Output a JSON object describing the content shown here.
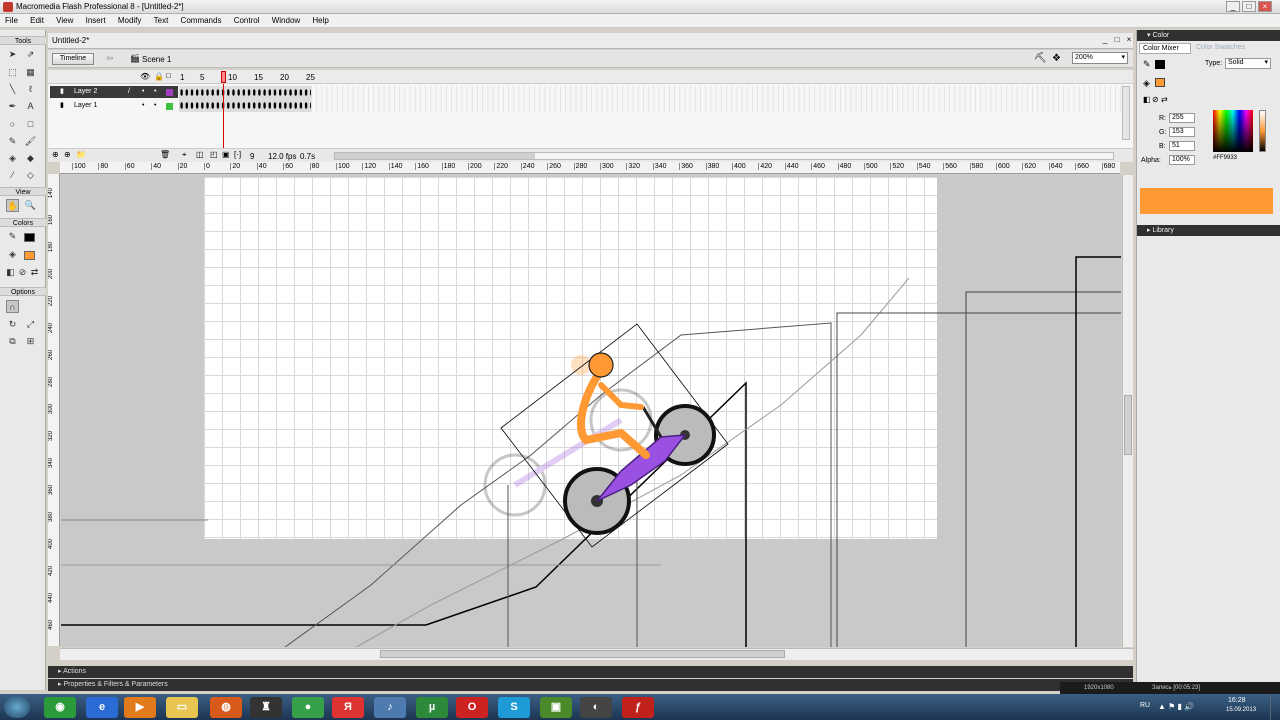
{
  "window": {
    "title": "Macromedia Flash Professional 8 - [Untitled-2*]"
  },
  "menu": [
    "File",
    "Edit",
    "View",
    "Insert",
    "Modify",
    "Text",
    "Commands",
    "Control",
    "Window",
    "Help"
  ],
  "tools": {
    "title": "Tools",
    "view_label": "View",
    "colors_label": "Colors",
    "options_label": "Options"
  },
  "document": {
    "tab": "Untitled-2*",
    "timeline_button": "Timeline",
    "scene": "Scene 1",
    "zoom": "200%"
  },
  "timeline": {
    "layers": [
      {
        "name": "Layer 2",
        "selected": true
      },
      {
        "name": "Layer 1",
        "selected": false
      }
    ],
    "frame_numbers": [
      "1",
      "5",
      "10",
      "15",
      "20",
      "25"
    ],
    "current_frame": "9",
    "fps": "12.0 fps",
    "time": "0.7s"
  },
  "ruler": {
    "h_ticks": [
      "100",
      "80",
      "60",
      "40",
      "20",
      "0",
      "20",
      "40",
      "60",
      "80",
      "100",
      "120",
      "140",
      "160",
      "180",
      "200",
      "220",
      "240",
      "260",
      "280",
      "300",
      "320",
      "340",
      "360",
      "380",
      "400",
      "420",
      "440",
      "460",
      "480",
      "500",
      "520",
      "540",
      "560",
      "580",
      "600",
      "620",
      "640",
      "660",
      "680"
    ],
    "v_ticks": [
      "140",
      "160",
      "180",
      "200",
      "220",
      "240",
      "260",
      "280",
      "300",
      "320",
      "340",
      "360",
      "380",
      "400",
      "420",
      "440",
      "460"
    ]
  },
  "panels": {
    "actions": "Actions",
    "properties": "Properties & Filters & Parameters"
  },
  "color_panel": {
    "title": "Color",
    "tab_mixer": "Color Mixer",
    "tab_swatches": "Color Swatches",
    "type_label": "Type:",
    "type_value": "Solid",
    "r_label": "R:",
    "r_value": "255",
    "g_label": "G:",
    "g_value": "153",
    "b_label": "B:",
    "b_value": "51",
    "alpha_label": "Alpha:",
    "alpha_value": "100%",
    "hex": "#FF9933",
    "swatch_color": "#FF9933"
  },
  "library": {
    "title": "Library"
  },
  "status_strip": {
    "resolution": "1920x1080",
    "recording": "Запись [00:05:23]"
  },
  "taskbar": {
    "lang": "RU",
    "time": "16:28",
    "date": "15.09.2013",
    "apps": [
      "chrome-icon",
      "ie-icon",
      "media-player-icon",
      "explorer-icon",
      "firefox-icon",
      "gamepad-icon",
      "ball-icon",
      "yandex-icon",
      "audio-icon",
      "utorrent-icon",
      "opera-icon",
      "skype-icon",
      "minecraft-icon",
      "recorder-icon",
      "flash-icon"
    ]
  }
}
